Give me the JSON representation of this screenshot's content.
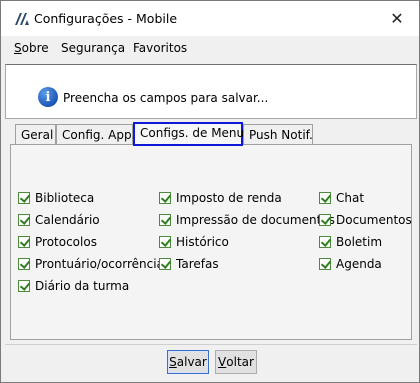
{
  "window": {
    "title": "Configurações - Mobile",
    "close_glyph": "✕",
    "app_icon": "app-logo-icon"
  },
  "menu": {
    "items": [
      {
        "label_first": "S",
        "label_rest": "obre"
      },
      {
        "label": "Segurança"
      },
      {
        "label": "Favoritos"
      }
    ]
  },
  "info": {
    "icon": "info-icon",
    "glyph": "i",
    "message": "Preencha os campos para salvar..."
  },
  "tabs": [
    {
      "label": "Geral",
      "active": false
    },
    {
      "label": "Config. App.",
      "active": false
    },
    {
      "label": "Configs. de Menu",
      "active": true
    },
    {
      "label": "Push Notif.",
      "active": false
    }
  ],
  "menu_options": {
    "column1": [
      {
        "label": "Biblioteca",
        "checked": true
      },
      {
        "label": "Calendário",
        "checked": true
      },
      {
        "label": "Protocolos",
        "checked": true
      },
      {
        "label": "Prontuário/ocorrências",
        "checked": true
      },
      {
        "label": "Diário da turma",
        "checked": true
      }
    ],
    "column2": [
      {
        "label": "Imposto de renda",
        "checked": true
      },
      {
        "label": "Impressão de documentos",
        "checked": true
      },
      {
        "label": "Histórico",
        "checked": true
      },
      {
        "label": "Tarefas",
        "checked": true
      }
    ],
    "column3": [
      {
        "label": "Chat",
        "checked": true
      },
      {
        "label": "Documentos",
        "checked": true
      },
      {
        "label": "Boletim",
        "checked": true
      },
      {
        "label": "Agenda",
        "checked": true
      }
    ]
  },
  "buttons": {
    "save_first": "S",
    "save_rest": "alvar",
    "back_first": "V",
    "back_rest": "oltar"
  },
  "colors": {
    "active_tab_border": "#1018d8",
    "checkbox_check": "#2e7d1f",
    "info_icon": "#1b57b8"
  }
}
